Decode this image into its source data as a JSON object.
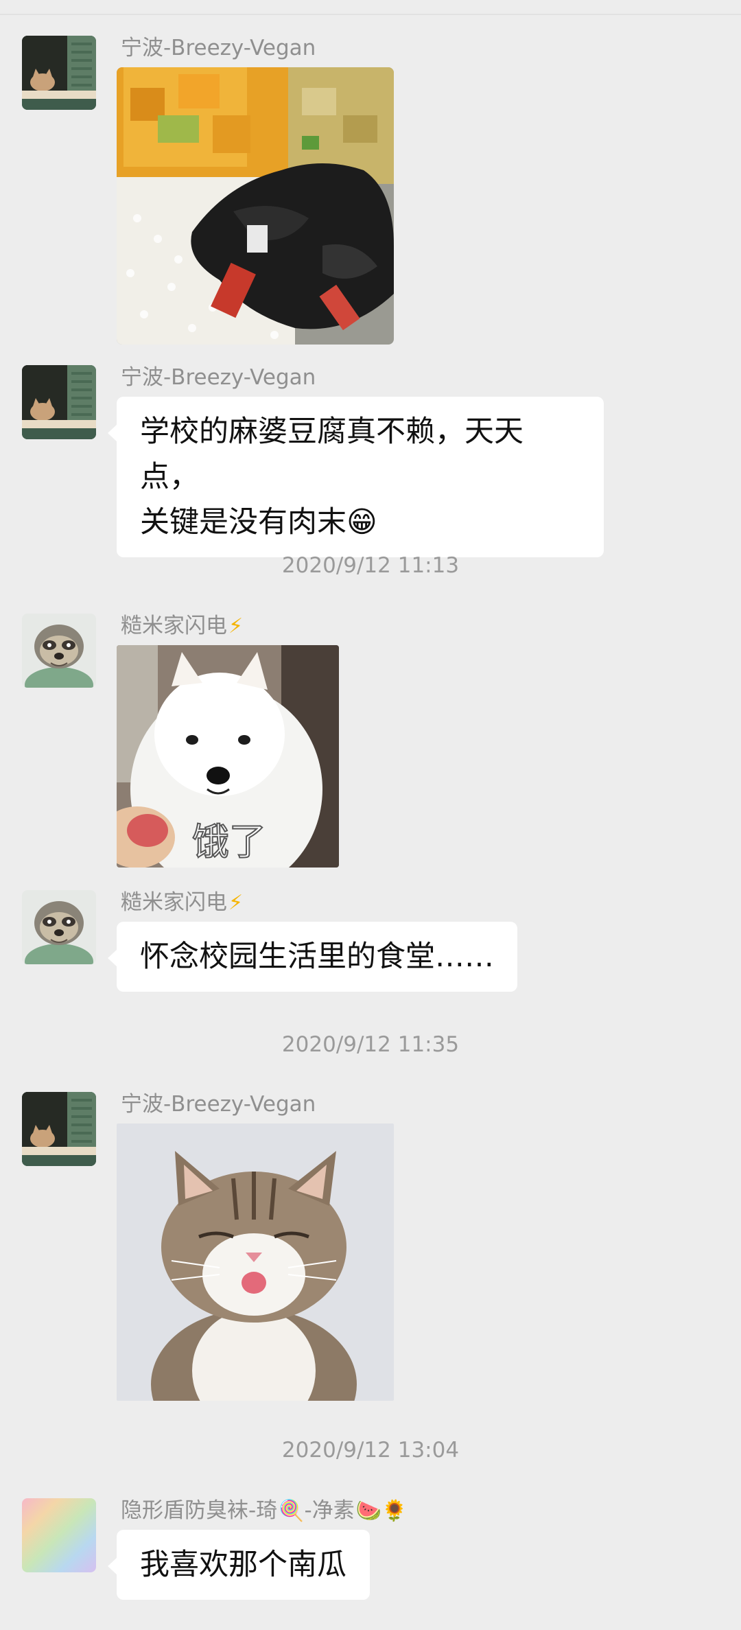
{
  "messages": [
    {
      "sender": "宁波-Breezy-Vegan",
      "type": "image",
      "image": "food-tray-photo"
    },
    {
      "sender": "宁波-Breezy-Vegan",
      "type": "text",
      "text_line1": "学校的麻婆豆腐真不赖，天天点，",
      "text_line2": "关键是没有肉末",
      "emoji": "😁"
    },
    {
      "sender": "糙米家闪电",
      "sender_emoji": "⚡",
      "type": "image",
      "image": "samoyed-dog-sticker",
      "sticker_text": "饿了"
    },
    {
      "sender": "糙米家闪电",
      "sender_emoji": "⚡",
      "type": "text",
      "text": "怀念校园生活里的食堂……"
    },
    {
      "sender": "宁波-Breezy-Vegan",
      "type": "image",
      "image": "cat-tongue-sticker"
    },
    {
      "sender": "隐形盾防臭袜-琦",
      "sender_mid": "🍭",
      "sender_tail": "-净素",
      "sender_emoji2": "🍉🌻",
      "type": "text",
      "text": "我喜欢那个南瓜"
    }
  ],
  "timestamps": [
    "2020/9/12 11:13",
    "2020/9/12 11:35",
    "2020/9/12 13:04"
  ],
  "colors": {
    "background": "#ededed",
    "bubble": "#ffffff",
    "sender_text": "#8f8f8f",
    "timestamp_text": "#9a9a9a"
  }
}
